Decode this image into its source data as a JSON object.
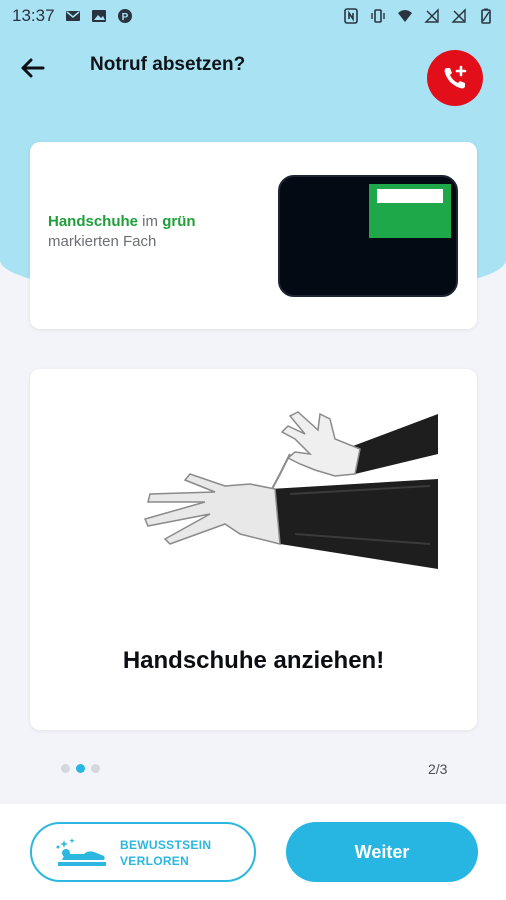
{
  "status_bar": {
    "time": "13:37",
    "left_icons": [
      "mail-icon",
      "image-icon",
      "p-app-icon"
    ],
    "right_icons": [
      "nfc-icon",
      "vibrate-icon",
      "wifi-icon",
      "no-signal-icon",
      "no-signal-icon",
      "battery-icon"
    ]
  },
  "header": {
    "title": "Notruf absetzen?",
    "back_icon": "arrow-left-icon",
    "call_icon": "phone-plus-icon",
    "call_color": "#e20f1b"
  },
  "card_instruction": {
    "highlight1": "Handschuhe",
    "text_mid": " im ",
    "highlight2": "grün",
    "line2": "markierten Fach",
    "highlight_color": "#1f9e3a"
  },
  "card_illustration": {
    "caption": "Handschuhe anziehen!"
  },
  "pagination": {
    "total_dots": 3,
    "active_dot": 2,
    "label": "2/3"
  },
  "bottom": {
    "unconscious_label_line1": "BEWUSSTSEIN",
    "unconscious_label_line2": "VERLOREN",
    "next_label": "Weiter",
    "accent_color": "#26b6e1"
  }
}
